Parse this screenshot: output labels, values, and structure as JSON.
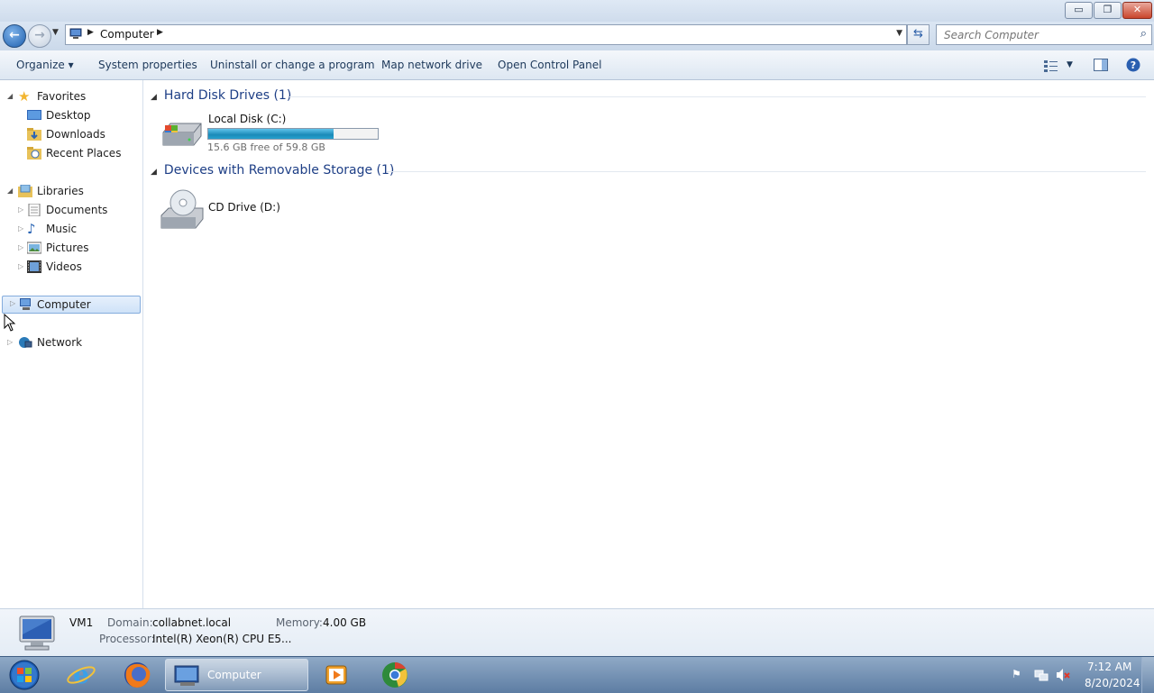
{
  "window": {
    "minimize_glyph": "▭",
    "maximize_glyph": "❐",
    "close_glyph": "✕"
  },
  "address": {
    "crumb": "Computer",
    "search_placeholder": "Search Computer"
  },
  "toolbar": {
    "organize": "Organize ▾",
    "system_properties": "System properties",
    "uninstall": "Uninstall or change a program",
    "map_drive": "Map network drive",
    "control_panel": "Open Control Panel"
  },
  "nav": {
    "favorites": "Favorites",
    "desktop": "Desktop",
    "downloads": "Downloads",
    "recent_places": "Recent Places",
    "libraries": "Libraries",
    "documents": "Documents",
    "music": "Music",
    "pictures": "Pictures",
    "videos": "Videos",
    "computer": "Computer",
    "network": "Network"
  },
  "content": {
    "hdd_group": "Hard Disk Drives (1)",
    "local_disk": "Local Disk (C:)",
    "local_disk_free": "15.6 GB free of 59.8 GB",
    "local_disk_used_fraction": 0.739,
    "removable_group": "Devices with Removable Storage (1)",
    "cd_drive": "CD Drive (D:)"
  },
  "details": {
    "name": "VM1",
    "domain_label": "Domain:",
    "domain_value": "collabnet.local",
    "memory_label": "Memory:",
    "memory_value": "4.00 GB",
    "processor_label": "Processor:",
    "processor_value": "Intel(R) Xeon(R) CPU E5..."
  },
  "taskbar": {
    "active_window": "Computer",
    "time": "7:12 AM",
    "date": "8/20/2024"
  },
  "colors": {
    "accent": "#1e3f86",
    "capacity_fill": "#26a0cf"
  }
}
